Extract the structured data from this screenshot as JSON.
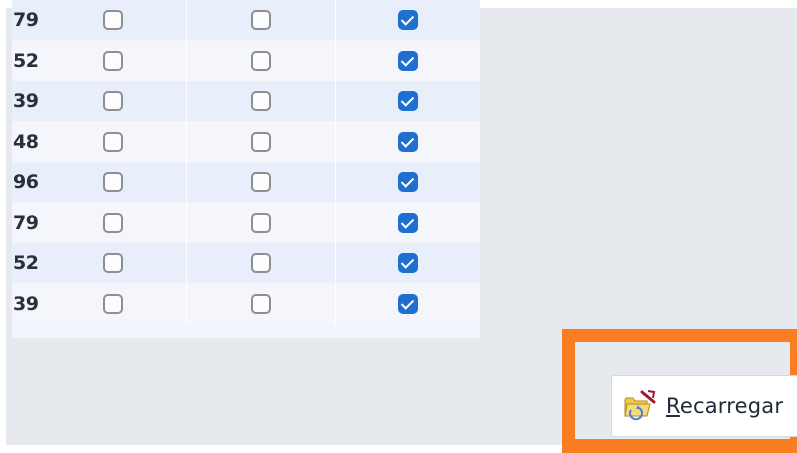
{
  "grid": {
    "rows": [
      {
        "id": "79",
        "col1": false,
        "col2": false,
        "col3": true
      },
      {
        "id": "52",
        "col1": false,
        "col2": false,
        "col3": true
      },
      {
        "id": "39",
        "col1": false,
        "col2": false,
        "col3": true
      },
      {
        "id": "48",
        "col1": false,
        "col2": false,
        "col3": true
      },
      {
        "id": "96",
        "col1": false,
        "col2": false,
        "col3": true
      },
      {
        "id": "79",
        "col1": false,
        "col2": false,
        "col3": true
      },
      {
        "id": "52",
        "col1": false,
        "col2": false,
        "col3": true
      },
      {
        "id": "39",
        "col1": false,
        "col2": false,
        "col3": true
      }
    ]
  },
  "toolbar": {
    "reload_mnemonic": "R",
    "reload_rest": "ecarregar",
    "reload_icon": "folder-refresh-icon"
  },
  "colors": {
    "highlight": "#fb7d22",
    "checked": "#1f6fd1"
  }
}
